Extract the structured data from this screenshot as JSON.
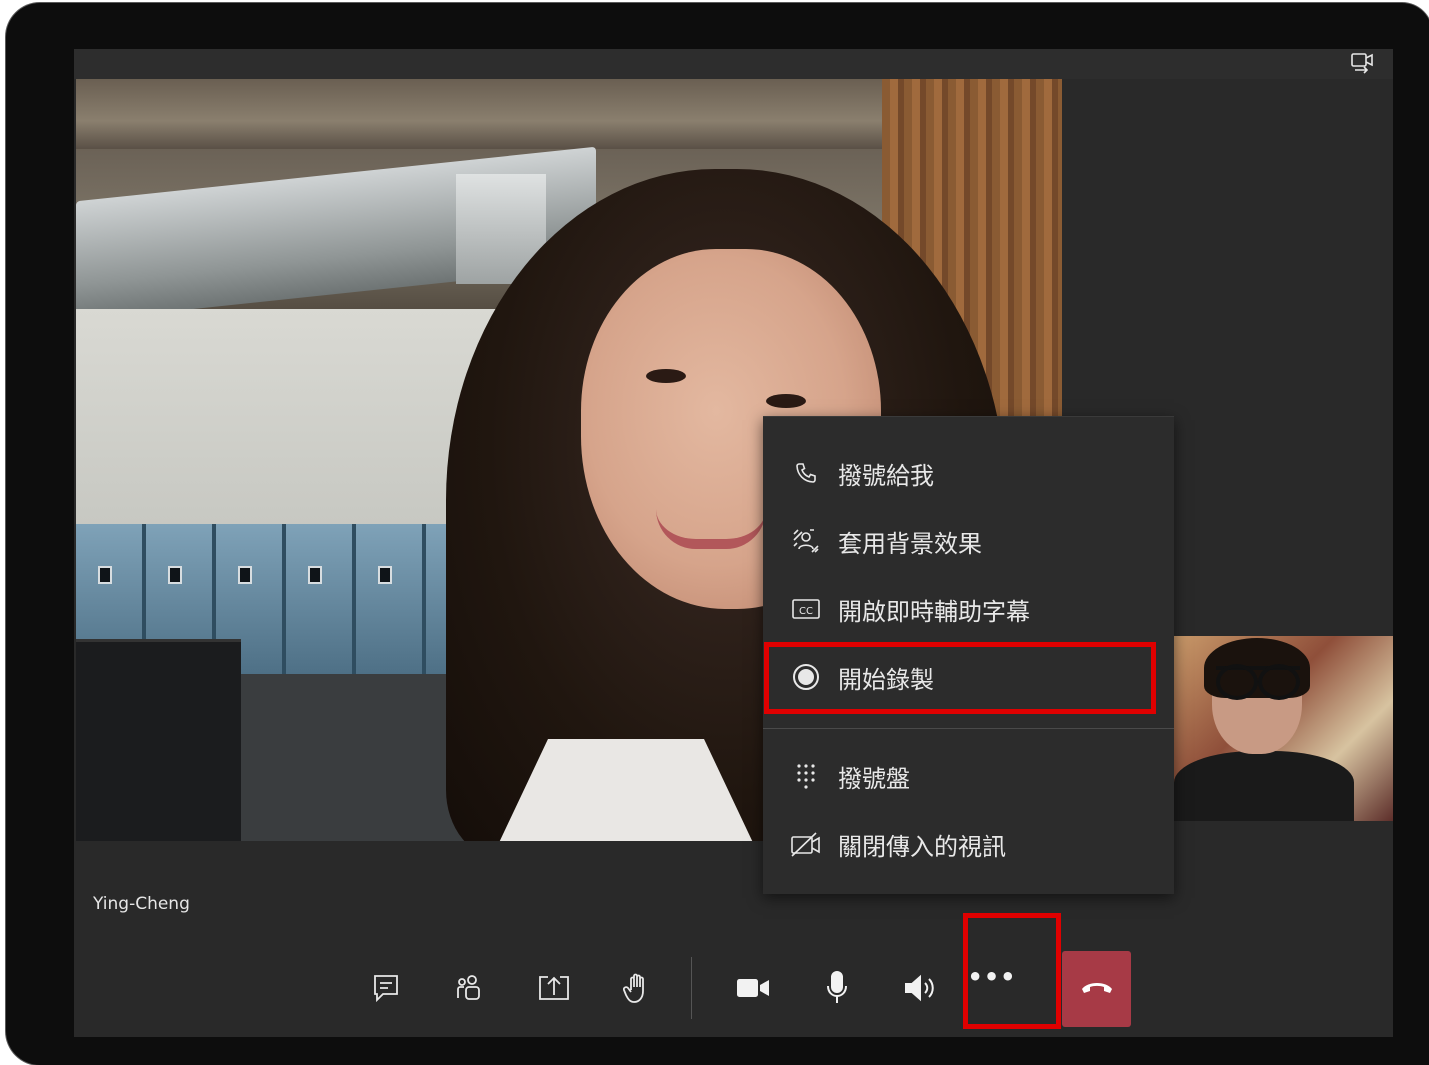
{
  "participant": {
    "name": "Ying-Cheng"
  },
  "menu": {
    "items": [
      {
        "label": "撥號給我",
        "icon": "phone-icon"
      },
      {
        "label": "套用背景效果",
        "icon": "background-effects-icon"
      },
      {
        "label": "開啟即時輔助字幕",
        "icon": "closed-captions-icon"
      },
      {
        "label": "開始錄製",
        "icon": "record-icon"
      },
      {
        "label": "撥號盤",
        "icon": "dialpad-icon"
      },
      {
        "label": "關閉傳入的視訊",
        "icon": "video-off-icon"
      }
    ]
  },
  "toolbar": {
    "buttons": [
      {
        "name": "chat",
        "icon": "chat-icon"
      },
      {
        "name": "participants",
        "icon": "participants-icon"
      },
      {
        "name": "share",
        "icon": "share-screen-icon"
      },
      {
        "name": "raise-hand",
        "icon": "raise-hand-icon"
      },
      {
        "name": "camera",
        "icon": "camera-icon"
      },
      {
        "name": "microphone",
        "icon": "microphone-icon"
      },
      {
        "name": "speaker",
        "icon": "speaker-icon"
      }
    ],
    "more_label": "•••",
    "hangup_icon": "hangup-icon"
  },
  "colors": {
    "highlight": "#e00000",
    "hangup": "#a73a46",
    "menu_bg": "#2c2c2c",
    "screen_bg": "#292929"
  }
}
